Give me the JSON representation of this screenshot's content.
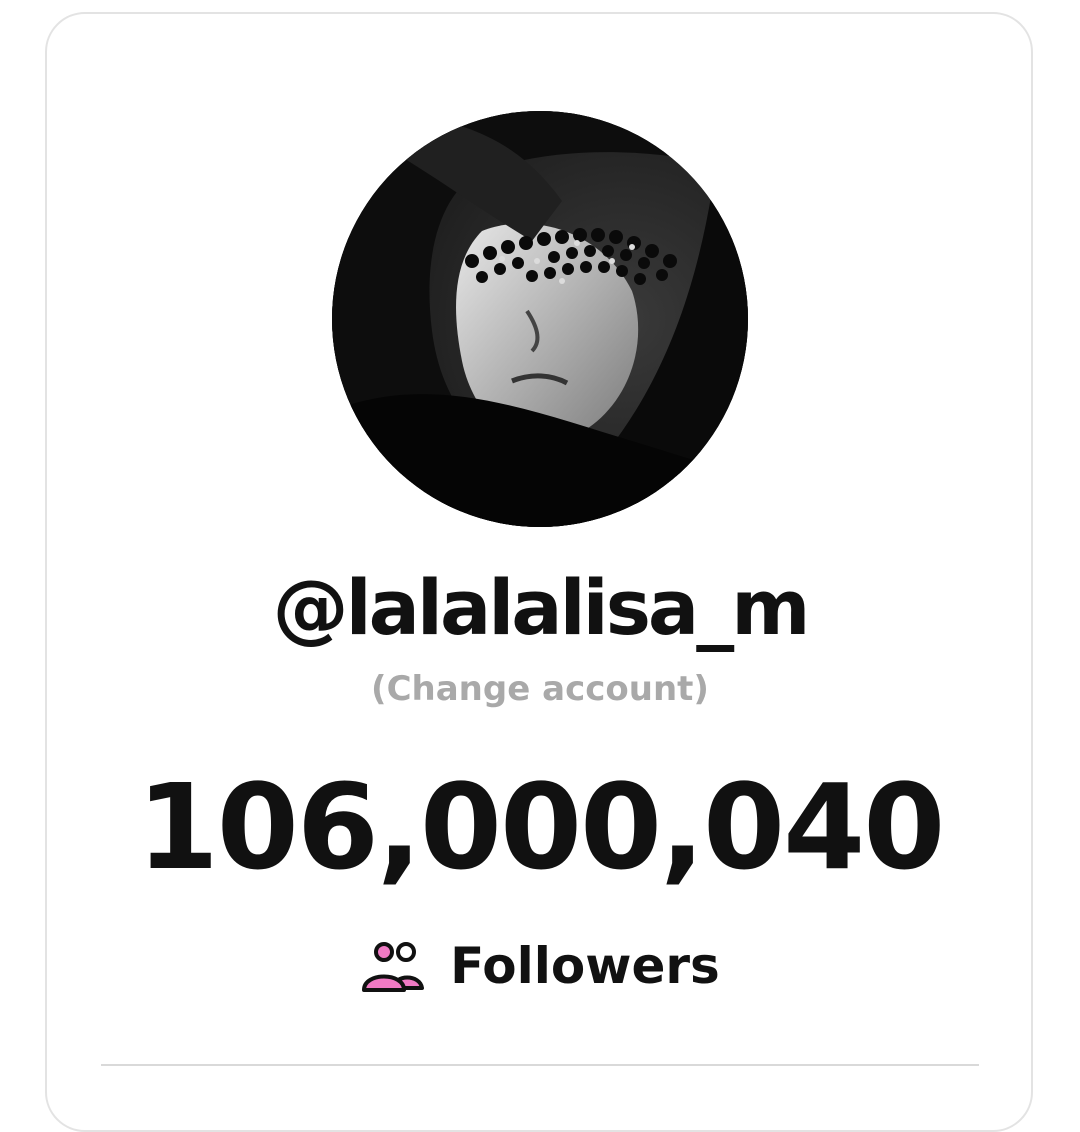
{
  "profile": {
    "username": "@lalalalisa_m",
    "change_account_label": "(Change account)",
    "follower_count": "106,000,040",
    "followers_label": "Followers",
    "avatar": "profile-photo",
    "followers_icon": "users-icon"
  },
  "colors": {
    "text": "#111111",
    "muted": "#a9a9a9",
    "accent": "#f07ac4",
    "border": "#e3e3e3"
  }
}
